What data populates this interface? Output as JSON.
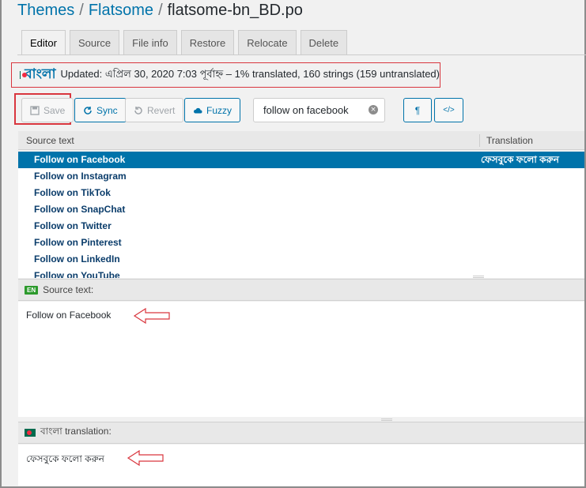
{
  "breadcrumb": {
    "themes": "Themes",
    "flatsome": "Flatsome",
    "file": "flatsome-bn_BD.po",
    "sep": "/"
  },
  "tabs": [
    {
      "label": "Editor",
      "active": true
    },
    {
      "label": "Source"
    },
    {
      "label": "File info"
    },
    {
      "label": "Restore"
    },
    {
      "label": "Relocate"
    },
    {
      "label": "Delete"
    }
  ],
  "banner": {
    "language": "বাংলা",
    "info": "Updated: এপ্রিল 30, 2020 7:03 পূর্বাহ্ন – 1% translated, 160 strings (159 untranslated)"
  },
  "toolbar": {
    "save": "Save",
    "sync": "Sync",
    "revert": "Revert",
    "fuzzy": "Fuzzy",
    "search_value": "follow on facebook",
    "pilcrow": "¶",
    "code": "</>"
  },
  "list": {
    "source_header": "Source text",
    "translation_header": "Translation",
    "rows": [
      {
        "source": "Follow on Facebook",
        "translation": "ফেসবুকে ফলো করুন",
        "selected": true
      },
      {
        "source": "Follow on Instagram",
        "translation": ""
      },
      {
        "source": "Follow on TikTok",
        "translation": ""
      },
      {
        "source": "Follow on SnapChat",
        "translation": ""
      },
      {
        "source": "Follow on Twitter",
        "translation": ""
      },
      {
        "source": "Follow on Pinterest",
        "translation": ""
      },
      {
        "source": "Follow on LinkedIn",
        "translation": ""
      },
      {
        "source": "Follow on YouTube",
        "translation": ""
      }
    ]
  },
  "source_pane": {
    "badge": "EN",
    "label": "Source text:",
    "text": "Follow on Facebook"
  },
  "translation_pane": {
    "label": "বাংলা translation:",
    "text": "ফেসবুকে ফলো করুন"
  },
  "colors": {
    "accent": "#0073aa",
    "highlight": "#d9363e",
    "selected_row": "#0073aa"
  }
}
